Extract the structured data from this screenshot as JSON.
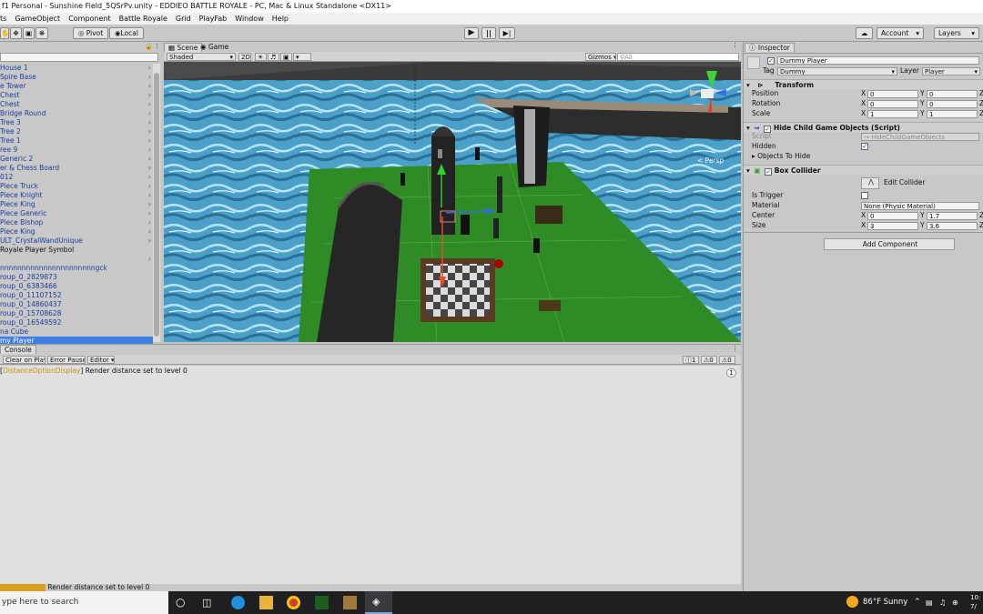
{
  "window": {
    "title": "f1 Personal - Sunshine Field_5QSrPv.unity - EDDIEO BATTLE ROYALE - PC, Mac & Linux Standalone <DX11>"
  },
  "menu": [
    "ts",
    "GameObject",
    "Component",
    "Battle Royale",
    "Grid",
    "PlayFab",
    "Window",
    "Help"
  ],
  "toolbar": {
    "pivot": "Pivot",
    "local": "Local",
    "account": "Account",
    "layers": "Layers"
  },
  "hierarchy": {
    "items": [
      {
        "label": "House 1",
        "arrow": true
      },
      {
        "label": "Spire Base",
        "arrow": true
      },
      {
        "label": "e Tower",
        "arrow": true
      },
      {
        "label": "Chest",
        "arrow": true
      },
      {
        "label": "Chest",
        "arrow": true
      },
      {
        "label": "Bridge Round",
        "arrow": true
      },
      {
        "label": "Tree 3",
        "arrow": true
      },
      {
        "label": "Tree 2",
        "arrow": true
      },
      {
        "label": "Tree 1",
        "arrow": true
      },
      {
        "label": "ree 9",
        "arrow": true
      },
      {
        "label": "Generic 2",
        "arrow": true
      },
      {
        "label": "er & Chess Board",
        "arrow": true
      },
      {
        "label": "012",
        "arrow": true
      },
      {
        "label": "Piece Truck",
        "arrow": true
      },
      {
        "label": "Piece Knight",
        "arrow": true
      },
      {
        "label": "Piece King",
        "arrow": true
      },
      {
        "label": "Piece Generic",
        "arrow": true
      },
      {
        "label": "Piece Bishop",
        "arrow": true
      },
      {
        "label": "Piece King",
        "arrow": true
      },
      {
        "label": "ULT_CrystalWandUnique",
        "arrow": true
      },
      {
        "label": "Royale Player Symbol",
        "arrow": false,
        "black": true
      },
      {
        "label": "",
        "arrow": true
      },
      {
        "label": "nnnnnnnnnnnnnnnnnnnnnngck",
        "arrow": false
      },
      {
        "label": "roup_0_2829873",
        "arrow": false
      },
      {
        "label": "roup_0_6383466",
        "arrow": false
      },
      {
        "label": "roup_0_11107152",
        "arrow": false
      },
      {
        "label": "roup_0_14860437",
        "arrow": false
      },
      {
        "label": "roup_0_15708628",
        "arrow": false
      },
      {
        "label": "roup_0_16549592",
        "arrow": false
      },
      {
        "label": "na Cube",
        "arrow": false
      },
      {
        "label": "my Player",
        "arrow": false,
        "selected": true
      }
    ]
  },
  "scene": {
    "tab_scene": "Scene",
    "tab_game": "Game",
    "shading": "Shaded",
    "mode2d": "2D",
    "gizmos": "Gizmos",
    "search_placeholder": "All",
    "persp": "< Persp"
  },
  "inspector": {
    "tab": "Inspector",
    "object_name": "Dummy Player",
    "tag_label": "Tag",
    "tag_value": "Dummy",
    "layer_label": "Layer",
    "layer_value": "Player",
    "transform": {
      "title": "Transform",
      "position": {
        "label": "Position",
        "x": "0",
        "y": "0"
      },
      "rotation": {
        "label": "Rotation",
        "x": "0",
        "y": "0"
      },
      "scale": {
        "label": "Scale",
        "x": "1",
        "y": "1"
      }
    },
    "hide_script": {
      "title": "Hide Child Game Objects (Script)",
      "script_label": "Script",
      "script_value": "HideChildGameObjects",
      "hidden_label": "Hidden",
      "objects_label": "Objects To Hide"
    },
    "box_collider": {
      "title": "Box Collider",
      "edit_label": "Edit Collider",
      "trigger_label": "Is Trigger",
      "material_label": "Material",
      "material_value": "None (Physic Material)",
      "center": {
        "label": "Center",
        "x": "0",
        "y": "1.7"
      },
      "size": {
        "label": "Size",
        "x": "3",
        "y": "3.6"
      }
    },
    "add_component": "Add Component"
  },
  "console": {
    "tab": "Console",
    "clear_on_play": "Clear on Play",
    "error_pause": "Error Pause",
    "editor": "Editor",
    "count_info": "1",
    "count_warn": "0",
    "count_err": "0",
    "message_class": "DistanceOptionDisplay",
    "message": "Render distance set to level 0",
    "message_count": "1"
  },
  "statusbar": {
    "message": "Render distance set to level 0"
  },
  "taskbar": {
    "search": "ype here to search",
    "weather": "86°F  Sunny",
    "time": "10:",
    "date": "7/"
  },
  "axis": {
    "x": "X",
    "y": "Y",
    "z": "Z"
  }
}
